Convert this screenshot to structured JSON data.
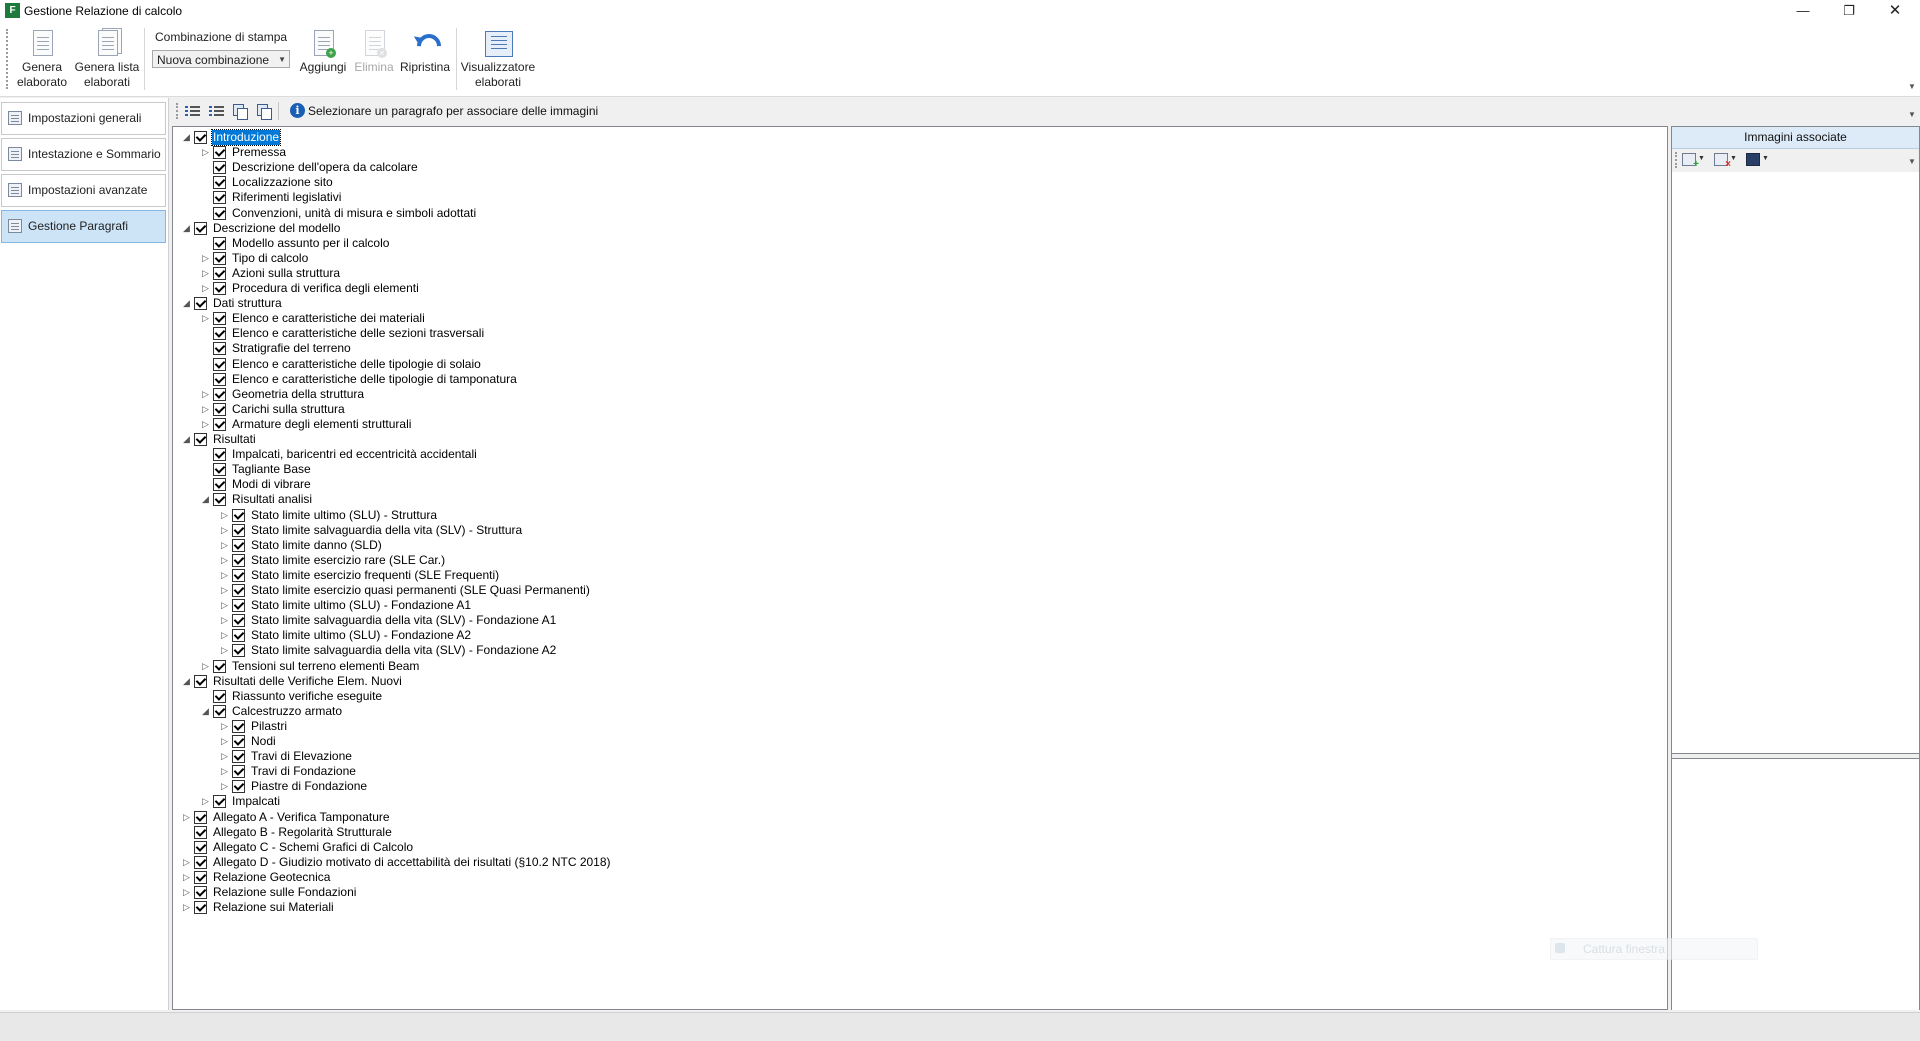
{
  "window": {
    "title": "Gestione Relazione di calcolo",
    "app_icon_letter": "F",
    "minimize": "—",
    "restore": "❐",
    "close": "✕"
  },
  "ribbon": {
    "genera_elaborato": [
      "Genera",
      "elaborato"
    ],
    "genera_lista": [
      "Genera lista",
      "elaborati"
    ],
    "combo_label": "Combinazione di stampa",
    "combo_value": "Nuova combinazione",
    "aggiungi": "Aggiungi",
    "elimina": "Elimina",
    "ripristina": "Ripristina",
    "visualizzatore": [
      "Visualizzatore",
      "elaborati"
    ]
  },
  "nav": [
    {
      "label": "Impostazioni generali",
      "active": false
    },
    {
      "label": "Intestazione e Sommario",
      "active": false
    },
    {
      "label": "Impostazioni avanzate",
      "active": false
    },
    {
      "label": "Gestione Paragrafi",
      "active": true
    }
  ],
  "tree_toolbar": {
    "info": "Selezionare un paragrafo per associare delle immagini"
  },
  "tree": [
    {
      "level": 0,
      "exp": "open",
      "label": "Introduzione",
      "selected": true
    },
    {
      "level": 1,
      "exp": "closed",
      "label": "Premessa"
    },
    {
      "level": 1,
      "exp": "none",
      "label": "Descrizione dell'opera da calcolare"
    },
    {
      "level": 1,
      "exp": "none",
      "label": "Localizzazione sito"
    },
    {
      "level": 1,
      "exp": "none",
      "label": "Riferimenti legislativi"
    },
    {
      "level": 1,
      "exp": "none",
      "label": "Convenzioni, unità di misura e simboli adottati"
    },
    {
      "level": 0,
      "exp": "open",
      "label": "Descrizione del modello"
    },
    {
      "level": 1,
      "exp": "none",
      "label": "Modello assunto per il calcolo"
    },
    {
      "level": 1,
      "exp": "closed",
      "label": "Tipo di calcolo"
    },
    {
      "level": 1,
      "exp": "closed",
      "label": "Azioni sulla struttura"
    },
    {
      "level": 1,
      "exp": "closed",
      "label": "Procedura di verifica degli elementi"
    },
    {
      "level": 0,
      "exp": "open",
      "label": "Dati struttura"
    },
    {
      "level": 1,
      "exp": "closed",
      "label": "Elenco e caratteristiche dei materiali"
    },
    {
      "level": 1,
      "exp": "none",
      "label": "Elenco e caratteristiche delle sezioni trasversali"
    },
    {
      "level": 1,
      "exp": "none",
      "label": "Stratigrafie del terreno"
    },
    {
      "level": 1,
      "exp": "none",
      "label": "Elenco e caratteristiche delle tipologie di solaio"
    },
    {
      "level": 1,
      "exp": "none",
      "label": "Elenco e caratteristiche delle tipologie di tamponatura"
    },
    {
      "level": 1,
      "exp": "closed",
      "label": "Geometria della struttura"
    },
    {
      "level": 1,
      "exp": "closed",
      "label": "Carichi sulla struttura"
    },
    {
      "level": 1,
      "exp": "closed",
      "label": "Armature degli elementi strutturali"
    },
    {
      "level": 0,
      "exp": "open",
      "label": "Risultati"
    },
    {
      "level": 1,
      "exp": "none",
      "label": "Impalcati, baricentri ed eccentricità accidentali"
    },
    {
      "level": 1,
      "exp": "none",
      "label": "Tagliante Base"
    },
    {
      "level": 1,
      "exp": "none",
      "label": "Modi di vibrare"
    },
    {
      "level": 1,
      "exp": "open",
      "label": "Risultati analisi"
    },
    {
      "level": 2,
      "exp": "closed",
      "label": "Stato limite ultimo (SLU) - Struttura"
    },
    {
      "level": 2,
      "exp": "closed",
      "label": "Stato limite salvaguardia della vita (SLV) - Struttura"
    },
    {
      "level": 2,
      "exp": "closed",
      "label": "Stato limite danno (SLD)"
    },
    {
      "level": 2,
      "exp": "closed",
      "label": "Stato limite esercizio rare (SLE Car.)"
    },
    {
      "level": 2,
      "exp": "closed",
      "label": "Stato limite esercizio frequenti (SLE Frequenti)"
    },
    {
      "level": 2,
      "exp": "closed",
      "label": "Stato limite esercizio quasi permanenti (SLE Quasi Permanenti)"
    },
    {
      "level": 2,
      "exp": "closed",
      "label": "Stato limite ultimo (SLU) - Fondazione A1"
    },
    {
      "level": 2,
      "exp": "closed",
      "label": "Stato limite salvaguardia della vita (SLV) - Fondazione A1"
    },
    {
      "level": 2,
      "exp": "closed",
      "label": "Stato limite ultimo (SLU) - Fondazione A2"
    },
    {
      "level": 2,
      "exp": "closed",
      "label": "Stato limite salvaguardia della vita (SLV) - Fondazione A2"
    },
    {
      "level": 1,
      "exp": "closed",
      "label": "Tensioni sul terreno elementi Beam"
    },
    {
      "level": 0,
      "exp": "open",
      "label": "Risultati delle Verifiche Elem. Nuovi"
    },
    {
      "level": 1,
      "exp": "none",
      "label": "Riassunto verifiche eseguite"
    },
    {
      "level": 1,
      "exp": "open",
      "label": "Calcestruzzo armato"
    },
    {
      "level": 2,
      "exp": "closed",
      "label": "Pilastri"
    },
    {
      "level": 2,
      "exp": "closed",
      "label": "Nodi"
    },
    {
      "level": 2,
      "exp": "closed",
      "label": "Travi di Elevazione"
    },
    {
      "level": 2,
      "exp": "closed",
      "label": "Travi di Fondazione"
    },
    {
      "level": 2,
      "exp": "closed",
      "label": "Piastre di Fondazione"
    },
    {
      "level": 1,
      "exp": "closed",
      "label": "Impalcati"
    },
    {
      "level": 0,
      "exp": "closed",
      "label": "Allegato A - Verifica Tamponature"
    },
    {
      "level": 0,
      "exp": "none",
      "label": "Allegato B - Regolarità Strutturale"
    },
    {
      "level": 0,
      "exp": "none",
      "label": "Allegato C - Schemi Grafici di Calcolo"
    },
    {
      "level": 0,
      "exp": "closed",
      "label": "Allegato D - Giudizio motivato di accettabilità dei risultati (§10.2 NTC 2018)"
    },
    {
      "level": 0,
      "exp": "closed",
      "label": "Relazione Geotecnica"
    },
    {
      "level": 0,
      "exp": "closed",
      "label": "Relazione sulle Fondazioni"
    },
    {
      "level": 0,
      "exp": "closed",
      "label": "Relazione sui Materiali"
    }
  ],
  "images_panel": {
    "header": "Immagini associate"
  },
  "faded_tip": "Cattura finestra",
  "colors": {
    "selection": "#0078d7",
    "nav_active": "#cde4f7",
    "header_bg": "#ddeaf7"
  }
}
